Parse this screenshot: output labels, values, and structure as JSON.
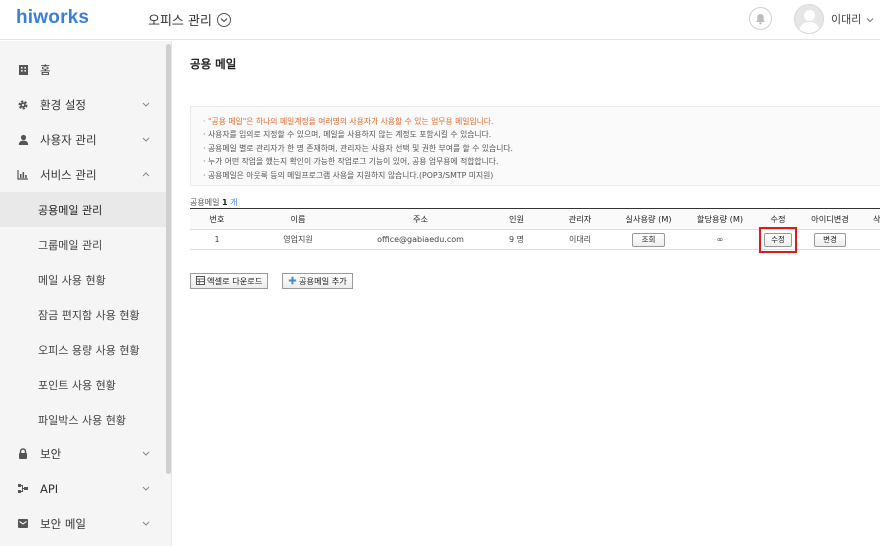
{
  "header": {
    "logo": "hiworks",
    "office_title": "오피스 관리",
    "user_name": "이대리"
  },
  "sidebar": {
    "items": [
      {
        "label": "홈",
        "icon": "building-icon"
      },
      {
        "label": "환경 설정",
        "icon": "gear-icon"
      },
      {
        "label": "사용자 관리",
        "icon": "user-icon"
      },
      {
        "label": "서비스 관리",
        "icon": "chart-icon"
      },
      {
        "label": "보안",
        "icon": "lock-icon"
      },
      {
        "label": "API",
        "icon": "api-icon"
      },
      {
        "label": "보안 메일",
        "icon": "mail-icon"
      }
    ],
    "sub_items": [
      "공용메일 관리",
      "그룹메일 관리",
      "메일 사용 현황",
      "잠금 편지함 사용 현황",
      "오피스 용량 사용 현황",
      "포인트 사용 현황",
      "파일박스 사용 현황"
    ]
  },
  "main": {
    "title": "공용 메일",
    "notices": [
      "\"공용 메일\"은 하나의 메일계정을 여러명의 사용자가 사용할 수 있는 업무용 메일입니다.",
      "사용자를 임의로 지정할 수 있으며, 메일을 사용하지 않는 계정도 포함시킬 수 있습니다.",
      "공용메일 별로 관리자가 한 명 존재하며, 관리자는 사용자 선택 및 권한 부여를 할 수 있습니다.",
      "누가 어떤 작업을 했는지 확인이 가능한 작업로그 기능이 있어, 공용 업무용에 적합합니다.",
      "공용메일은 아웃룩 등의 메일프로그램 사용을 지원하지 않습니다.(POP3/SMTP 미지원)"
    ],
    "count_label": "공용메일",
    "count_value": "1",
    "count_unit": "개",
    "table": {
      "headers": [
        "번호",
        "이름",
        "주소",
        "인원",
        "관리자",
        "실사용량 (M)",
        "할당용량 (M)",
        "수정",
        "아이디변경",
        "삭"
      ],
      "rows": [
        {
          "no": "1",
          "name": "영업지원",
          "address": "office@gabiaedu.com",
          "members": "9 명",
          "manager": "이대리",
          "usage_button": "조회",
          "quota": "∞",
          "edit_button": "수정",
          "id_change_button": "변경"
        }
      ]
    },
    "excel_download": "엑셀로 다운로드",
    "add_shared_mail": "공용메일 추가"
  }
}
